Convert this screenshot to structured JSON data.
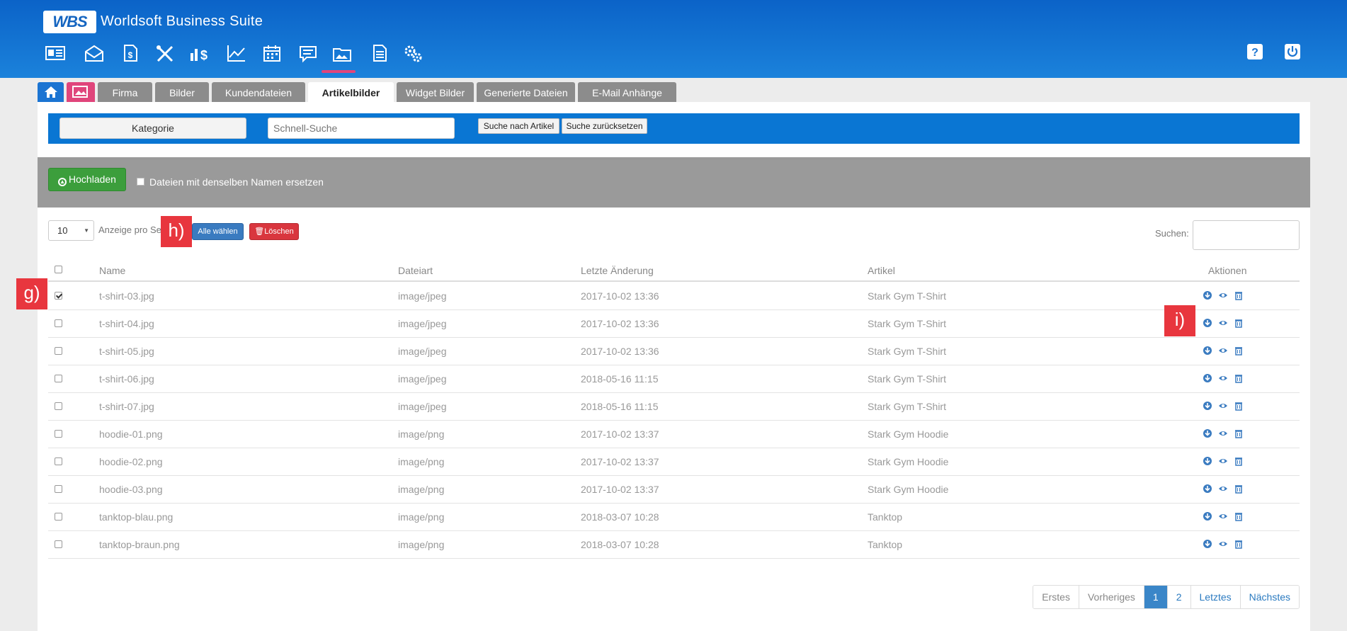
{
  "header": {
    "logo_text": "WBS",
    "app_title": "Worldsoft Business Suite",
    "modules": [
      {
        "icon": "contact-card-icon"
      },
      {
        "icon": "mail-icon"
      },
      {
        "icon": "document-dollar-icon"
      },
      {
        "icon": "tools-icon"
      },
      {
        "icon": "sales-dollar-icon"
      },
      {
        "icon": "chart-line-icon"
      },
      {
        "icon": "calendar-icon"
      },
      {
        "icon": "comment-icon"
      },
      {
        "icon": "file-manager-icon"
      },
      {
        "icon": "newsletter-icon"
      },
      {
        "icon": "settings-gears-icon"
      }
    ],
    "help_icon": "help-icon",
    "power_icon": "power-icon"
  },
  "tabs": {
    "home": "home-icon",
    "files": "file-manager-icon",
    "items": [
      "Firma",
      "Bilder",
      "Kundendateien",
      "Artikelbilder",
      "Widget Bilder",
      "Generierte Dateien",
      "E-Mail Anhänge"
    ],
    "active": "Artikelbilder"
  },
  "filter": {
    "category_label": "Kategorie",
    "quick_search_placeholder": "Schnell-Suche",
    "search_article_label": "Suche nach Artikel",
    "reset_search_label": "Suche zurücksetzen"
  },
  "upload": {
    "button_label": "Hochladen",
    "replace_label": "Dateien mit denselben Namen ersetzen"
  },
  "table_controls": {
    "page_length": "10",
    "length_label": "Anzeige pro Se",
    "select_all_label": "Alle wählen",
    "delete_label": "Löschen",
    "search_label": "Suchen:"
  },
  "table": {
    "columns": [
      "Name",
      "Dateiart",
      "Letzte Änderung",
      "Artikel",
      "Aktionen"
    ],
    "rows": [
      {
        "name": "t-shirt-03.jpg",
        "type": "image/jpeg",
        "modified": "2017-10-02 13:36",
        "article": "Stark Gym T-Shirt",
        "checked": true
      },
      {
        "name": "t-shirt-04.jpg",
        "type": "image/jpeg",
        "modified": "2017-10-02 13:36",
        "article": "Stark Gym T-Shirt",
        "checked": false
      },
      {
        "name": "t-shirt-05.jpg",
        "type": "image/jpeg",
        "modified": "2017-10-02 13:36",
        "article": "Stark Gym T-Shirt",
        "checked": false
      },
      {
        "name": "t-shirt-06.jpg",
        "type": "image/jpeg",
        "modified": "2018-05-16 11:15",
        "article": "Stark Gym T-Shirt",
        "checked": false
      },
      {
        "name": "t-shirt-07.jpg",
        "type": "image/jpeg",
        "modified": "2018-05-16 11:15",
        "article": "Stark Gym T-Shirt",
        "checked": false
      },
      {
        "name": "hoodie-01.png",
        "type": "image/png",
        "modified": "2017-10-02 13:37",
        "article": "Stark Gym Hoodie",
        "checked": false
      },
      {
        "name": "hoodie-02.png",
        "type": "image/png",
        "modified": "2017-10-02 13:37",
        "article": "Stark Gym Hoodie",
        "checked": false
      },
      {
        "name": "hoodie-03.png",
        "type": "image/png",
        "modified": "2017-10-02 13:37",
        "article": "Stark Gym Hoodie",
        "checked": false
      },
      {
        "name": "tanktop-blau.png",
        "type": "image/png",
        "modified": "2018-03-07 10:28",
        "article": "Tanktop",
        "checked": false
      },
      {
        "name": "tanktop-braun.png",
        "type": "image/png",
        "modified": "2018-03-07 10:28",
        "article": "Tanktop",
        "checked": false
      }
    ],
    "row_actions": [
      "download-icon",
      "view-eye-icon",
      "trash-icon"
    ]
  },
  "pagination": {
    "first": "Erstes",
    "previous": "Vorheriges",
    "pages": [
      "1",
      "2"
    ],
    "current": "1",
    "last": "Letztes",
    "next": "Nächstes"
  },
  "markers": {
    "g": "g)",
    "h": "h)",
    "i": "i)"
  },
  "colors": {
    "header_blue": "#1b74d2",
    "accent_pink": "#e0457b",
    "upload_green": "#3c9e3c",
    "delete_red": "#d9363e",
    "select_blue": "#3a7bc0",
    "marker_red": "#e8363e"
  }
}
